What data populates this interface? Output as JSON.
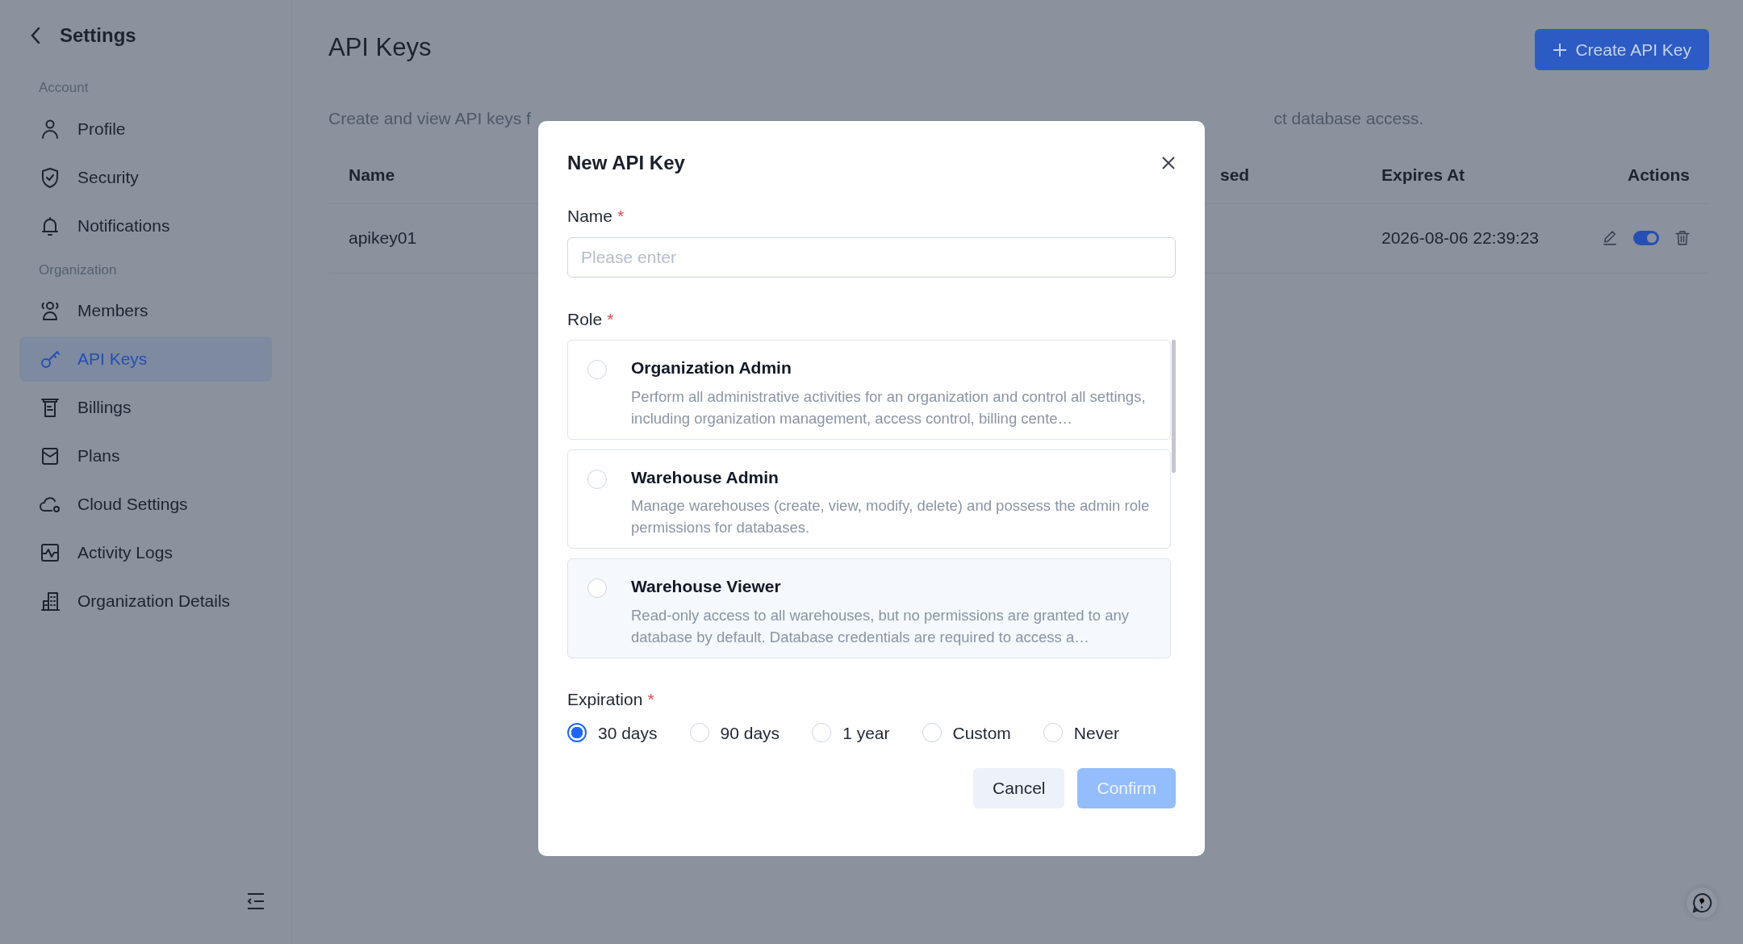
{
  "sidebar": {
    "title": "Settings",
    "sections": [
      {
        "label": "Account",
        "items": [
          {
            "label": "Profile",
            "selected": false
          },
          {
            "label": "Security",
            "selected": false
          },
          {
            "label": "Notifications",
            "selected": false
          }
        ]
      },
      {
        "label": "Organization",
        "items": [
          {
            "label": "Members",
            "selected": false
          },
          {
            "label": "API Keys",
            "selected": true
          },
          {
            "label": "Billings",
            "selected": false
          },
          {
            "label": "Plans",
            "selected": false
          },
          {
            "label": "Cloud Settings",
            "selected": false
          },
          {
            "label": "Activity Logs",
            "selected": false
          },
          {
            "label": "Organization Details",
            "selected": false
          }
        ]
      }
    ]
  },
  "page": {
    "title": "API Keys",
    "create_button": "Create API Key",
    "description_start": "Create and view API keys f",
    "description_end": "ct database access."
  },
  "table": {
    "columns": [
      "Name",
      "sed",
      "Expires At",
      "Actions"
    ],
    "rows": [
      {
        "name": "apikey01",
        "expires_at": "2026-08-06 22:39:23",
        "enabled": true
      }
    ]
  },
  "dialog": {
    "title": "New API Key",
    "name_field": {
      "label": "Name",
      "required_mark": "*",
      "placeholder": "Please enter"
    },
    "role": {
      "label": "Role",
      "required_mark": "*",
      "options": [
        {
          "title": "Organization Admin",
          "description": "Perform all administrative activities for an organization and control all settings, including organization management, access control, billing cente…",
          "selected": false
        },
        {
          "title": "Warehouse Admin",
          "description": "Manage warehouses (create, view, modify, delete) and possess the admin role permissions for databases.",
          "selected": false
        },
        {
          "title": "Warehouse Viewer",
          "description": "Read-only access to all warehouses, but no permissions are granted to any database by default. Database credentials are required to access a…",
          "selected": false
        }
      ]
    },
    "expiration": {
      "label": "Expiration",
      "required_mark": "*",
      "options": [
        {
          "label": "30 days",
          "selected": true
        },
        {
          "label": "90 days",
          "selected": false
        },
        {
          "label": "1 year",
          "selected": false
        },
        {
          "label": "Custom",
          "selected": false
        },
        {
          "label": "Never",
          "selected": false
        }
      ]
    },
    "cancel_button": "Cancel",
    "confirm_button": {
      "label": "Confirm",
      "disabled": true
    }
  }
}
